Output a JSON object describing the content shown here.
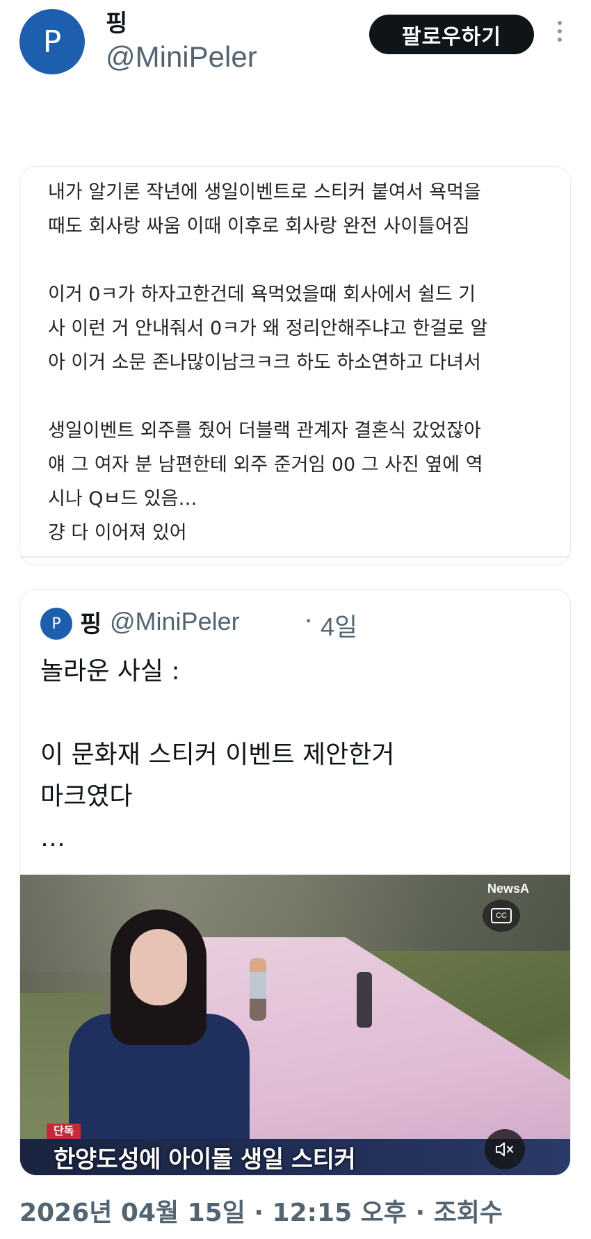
{
  "tweet": {
    "avatar_letter": "P",
    "display_name": "핑",
    "handle": "@MiniPeler",
    "follow_label": "팔로우하기"
  },
  "card_text": {
    "para1": [
      "내가 알기론 작년에 생일이벤트로 스티커 붙여서 욕먹을",
      "때도 회사랑 싸움 이때 이후로 회사랑 완전 사이틀어짐"
    ],
    "para2": [
      "이거 0ㅋ가 하자고한건데 욕먹었을때 회사에서 쉴드 기",
      "사 이런 거 안내줘서 0ㅋ가 왜 정리안해주냐고 한걸로 알",
      "아 이거 소문 존나많이남크ㅋ크 하도 하소연하고 다녀서"
    ],
    "para3": [
      "생일이벤트 외주를 줬어 더블랙 관계자 결혼식 갔었잖아",
      "얘 그 여자 분 남편한테 외주 준거임 00 그 사진 옆에 역",
      "시나 Qㅂ드 있음…",
      "걍 다 이어져 있어"
    ]
  },
  "quoted": {
    "avatar_letter": "P",
    "display_name": "핑",
    "handle": "@MiniPeler",
    "separator": "·",
    "time": "4일",
    "lines": [
      "놀라운 사실 :",
      "이 문화재 스티커 이벤트 제안한거",
      "마크였다",
      "…"
    ],
    "video": {
      "logo": "NewsA",
      "cc_label": "CC",
      "chyron_tag": "단독",
      "chyron_text": "한양도성에 아이돌 생일 스티커"
    }
  },
  "meta": {
    "date_line": "2026년 04월 15일 · 12:15 오후 · 조회수"
  }
}
